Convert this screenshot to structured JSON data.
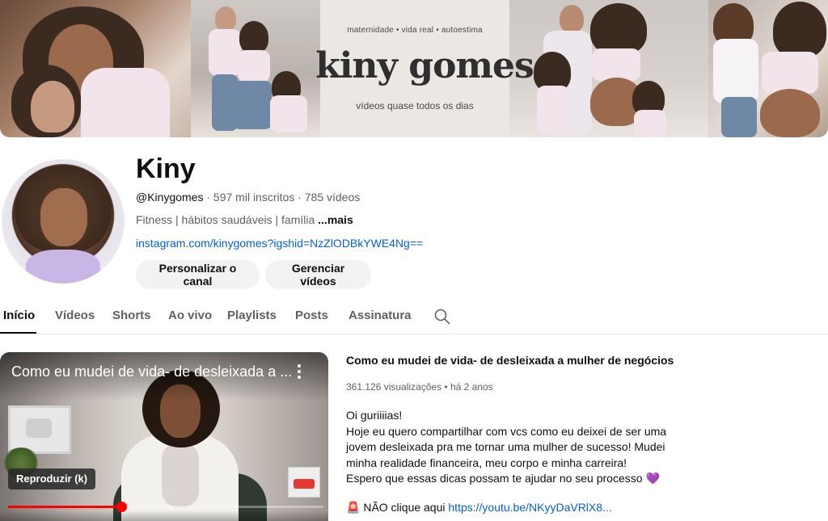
{
  "banner": {
    "tagline": "maternidade • vida real • autoestima",
    "logo_text": "kiny gomes",
    "subtitle": "vídeos quase todos os dias"
  },
  "channel": {
    "name": "Kiny",
    "handle": "@Kinygomes",
    "subscribers": "597 mil inscritos",
    "videos_count": "785 vídeos",
    "separator": " · ",
    "description": "Fitness | hábitos saudáveis | família",
    "more_label": "...mais",
    "link": "instagram.com/kinygomes?igshid=NzZlODBkYWE4Ng==",
    "buttons": {
      "customize": "Personalizar o canal",
      "manage": "Gerenciar vídeos"
    }
  },
  "tabs": [
    {
      "label": "Início",
      "active": true
    },
    {
      "label": "Vídeos"
    },
    {
      "label": "Shorts"
    },
    {
      "label": "Ao vivo"
    },
    {
      "label": "Playlists"
    },
    {
      "label": "Posts"
    },
    {
      "label": "Assinatura"
    }
  ],
  "search_icon": "search-icon",
  "featured_video": {
    "player_title": "Como eu mudei de vida- de desleixada a ...",
    "play_tooltip": "Reproduzir (k)",
    "progress": 0.36,
    "title": "Como eu mudei de vida- de desleixada a mulher de negócios",
    "views": "361.126 visualizações",
    "age": "há 2 anos",
    "meta_separator": " • ",
    "description_lines": [
      "Oi guriiiias!",
      "Hoje eu quero compartilhar com vcs como eu deixei de ser uma",
      "jovem desleixada pra me tornar uma mulher de sucesso! Mudei",
      "minha realidade financeira, meu corpo e minha carreira!",
      "Espero que essas dicas possam te ajudar no seu processo"
    ],
    "heart_emoji": "💜",
    "cta_emoji": "🚨",
    "cta_text": "NÃO clique aqui ",
    "cta_link": "https://youtu.be/NKyyDaVRlX8..."
  },
  "colors": {
    "link": "#065fd4",
    "progress_red": "#ff0000",
    "muted_text": "#606060"
  }
}
